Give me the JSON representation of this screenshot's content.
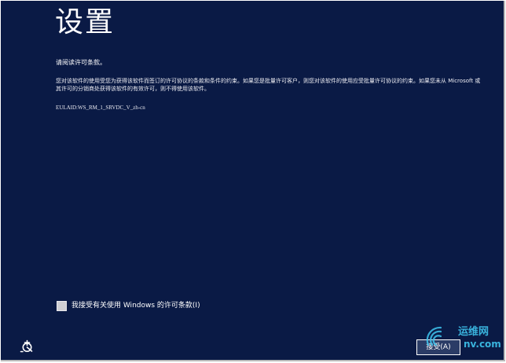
{
  "page": {
    "title": "设置",
    "subtitle": "请阅读许可条款。",
    "license_text": "您对该软件的使用受您为获得该软件而签订的许可协议的条款和条件的约束。如果您是批量许可客户，则您对该软件的使用应受批量许可协议的约束。如果您未从 Microsoft 或其许可的分销商处获得该软件的有效许可，则不得使用该软件。",
    "eula_id": "EULAID:WS_RM_1_SRVDC_V_zh-cn"
  },
  "accept": {
    "checkbox_label": "我接受有关使用 Windows 的许可条款(I)",
    "checked": false
  },
  "footer": {
    "accessibility_icon": "ease-of-access-icon",
    "accept_button_label": "接受(A)"
  },
  "watermark": {
    "line1": "运维网",
    "line2": "nv.com"
  },
  "colors": {
    "background": "#0a1a45",
    "text": "#ffffff",
    "checkbox": "#cfcfd4",
    "watermark": "#3fc4ee"
  }
}
